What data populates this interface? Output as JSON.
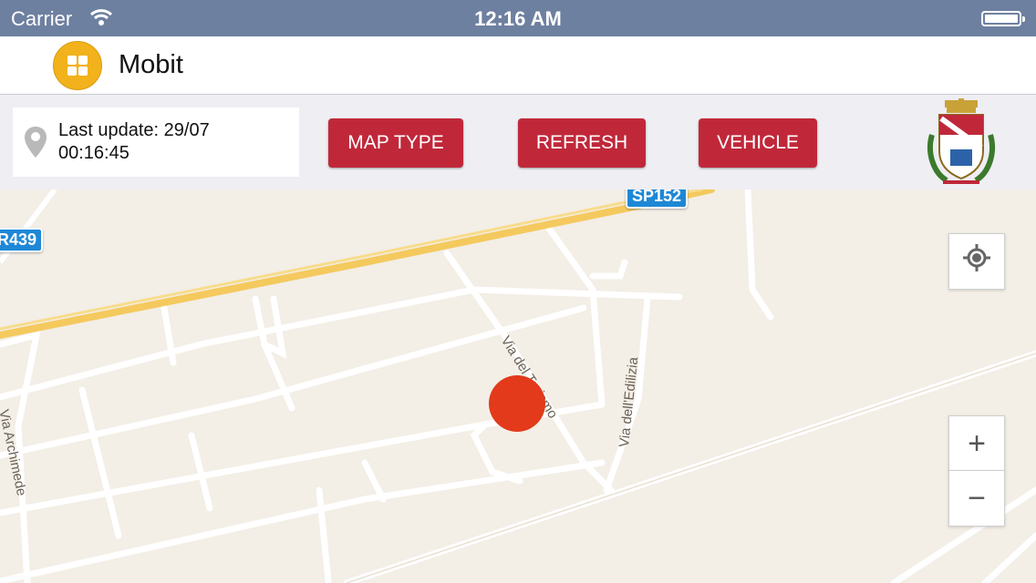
{
  "status_bar": {
    "carrier": "Carrier",
    "time": "12:16 AM"
  },
  "nav": {
    "title": "Mobit",
    "app_icon": "grid-icon"
  },
  "toolbar": {
    "last_update_line1": "Last update: 29/07",
    "last_update_line2": "00:16:45",
    "map_type_label": "MAP TYPE",
    "refresh_label": "REFRESH",
    "vehicle_label": "VEHICLE"
  },
  "map": {
    "road_badges": [
      "SP152",
      "R439"
    ],
    "street_labels": [
      "Via del Turismo",
      "Via dell'Edilizia",
      "Via Archimede"
    ],
    "controls": {
      "zoom_in": "+",
      "zoom_out": "−"
    }
  },
  "colors": {
    "accent": "#c0283a",
    "marker": "#e23a1b",
    "status_bar": "#6e80a0",
    "app_icon": "#f1b21c"
  }
}
